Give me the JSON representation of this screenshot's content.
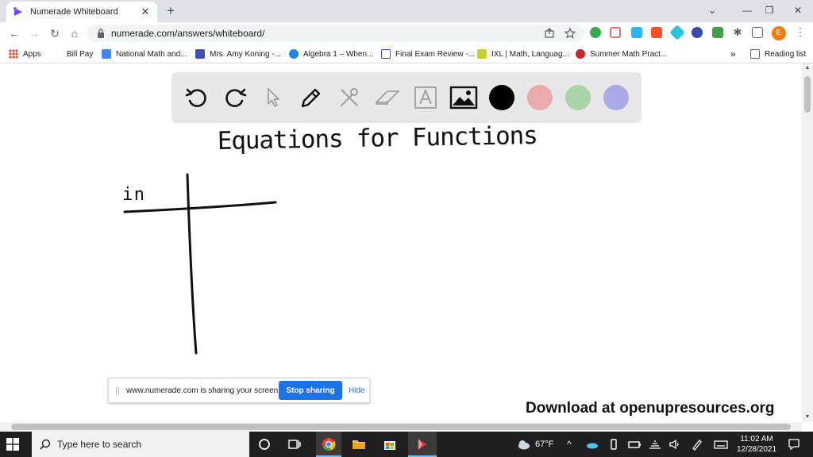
{
  "browser": {
    "tab_title": "Numerade Whiteboard",
    "tab_close": "✕",
    "new_tab": "+",
    "url": "numerade.com/answers/whiteboard/",
    "window_controls": {
      "minimize": "—",
      "restore": "❐",
      "close": "✕"
    }
  },
  "bookmarks": [
    {
      "label": "Apps",
      "color": "#ea4335"
    },
    {
      "label": "Bill Pay",
      "color": ""
    },
    {
      "label": "National Math and...",
      "color": "#4285f4"
    },
    {
      "label": "Mrs. Amy Koning -...",
      "color": "#3f51b5"
    },
    {
      "label": "Algebra 1 – When...",
      "color": "#1e88e5"
    },
    {
      "label": "Final Exam Review -...",
      "color": "#3f51b5"
    },
    {
      "label": "IXL | Math, Languag...",
      "color": "#c6d02b"
    },
    {
      "label": "Summer Math Pract...",
      "color": "#c62828"
    }
  ],
  "bookmarks_more": "»",
  "reading_list": "Reading list",
  "whiteboard": {
    "tools": [
      "undo-icon",
      "redo-icon",
      "pointer-icon",
      "pen-icon",
      "tools-icon",
      "eraser-icon",
      "text-icon",
      "image-icon"
    ],
    "colors": [
      "#000000",
      "#e8aaaa",
      "#a9d3a9",
      "#a9a9e8"
    ],
    "handwriting": {
      "title": "Equations for Functions",
      "table_label": "in"
    }
  },
  "share_bar": {
    "grip": "||",
    "message": "www.numerade.com is sharing your screen.",
    "stop_label": "Stop sharing",
    "hide_label": "Hide"
  },
  "watermark": "Download at openupresources.org",
  "taskbar": {
    "search_placeholder": "Type here to search",
    "weather": "67°F",
    "time": "11:02 AM",
    "date": "12/28/2021"
  },
  "accent_colors": {
    "chrome_blue": "#1a73e8",
    "taskbar": "#1f1f1f"
  },
  "profile_initial": "E"
}
